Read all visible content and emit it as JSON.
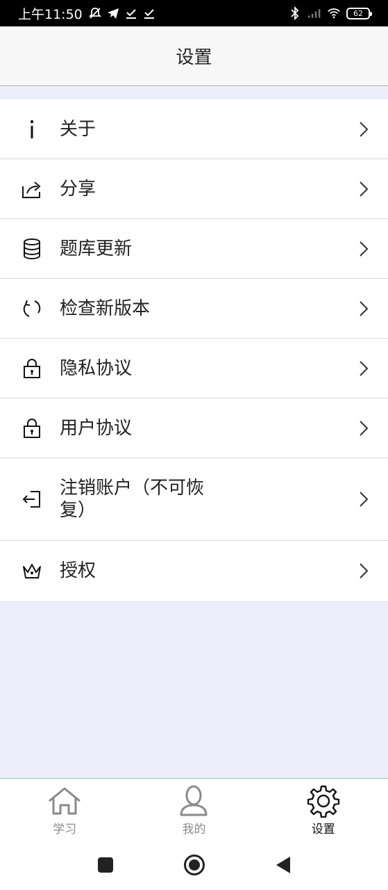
{
  "status_bar": {
    "time": "上午11:50",
    "battery": "62",
    "icons": [
      "mute-icon",
      "telegram-icon",
      "download-done-icon",
      "download-done-icon",
      "bluetooth-icon",
      "signal-icon",
      "wifi-icon",
      "battery-icon"
    ]
  },
  "header": {
    "title": "设置"
  },
  "menu": {
    "items": [
      {
        "icon": "info-icon",
        "label": "关于"
      },
      {
        "icon": "share-icon",
        "label": "分享"
      },
      {
        "icon": "database-icon",
        "label": "题库更新"
      },
      {
        "icon": "refresh-icon",
        "label": "检查新版本"
      },
      {
        "icon": "lock-icon",
        "label": "隐私协议"
      },
      {
        "icon": "lock-icon",
        "label": "用户协议"
      },
      {
        "icon": "logout-icon",
        "label": "注销账户（不可恢复）"
      },
      {
        "icon": "crown-icon",
        "label": "授权"
      }
    ]
  },
  "tabbar": {
    "tabs": [
      {
        "icon": "home-icon",
        "label": "学习",
        "active": false
      },
      {
        "icon": "user-icon",
        "label": "我的",
        "active": false
      },
      {
        "icon": "gear-icon",
        "label": "设置",
        "active": true
      }
    ]
  },
  "colors": {
    "content_background": "#eceefb",
    "tab_border": "#9cc7b6",
    "inactive_tab": "#8a8a8a"
  }
}
